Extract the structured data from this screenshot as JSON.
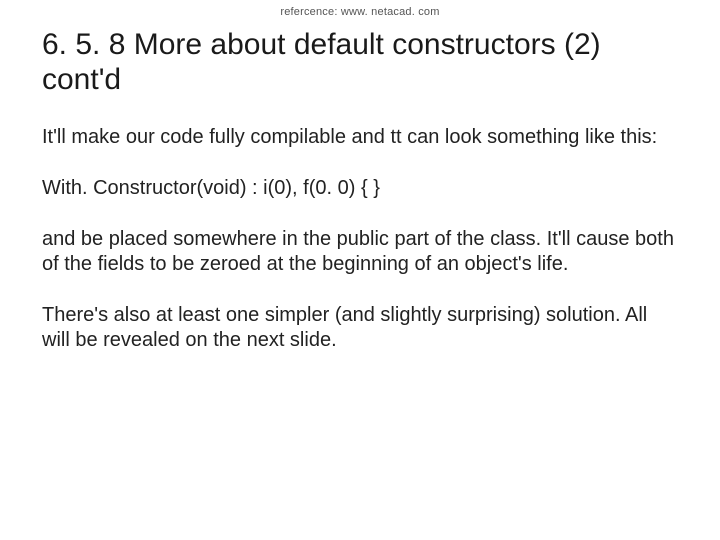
{
  "reference": "refercence: www. netacad. com",
  "title": "6. 5. 8 More about default constructors (2) cont'd",
  "paragraphs": {
    "p1": "It'll make our code fully compilable and tt can look something like this:",
    "p2": "With. Constructor(void) : i(0), f(0. 0) { }",
    "p3": "and be placed somewhere in the public part of the class. It'll cause both of the fields to be zeroed at the beginning of an object's life.",
    "p4": "There's also at least one simpler (and slightly surprising) solution. All will be revealed on the next slide."
  }
}
